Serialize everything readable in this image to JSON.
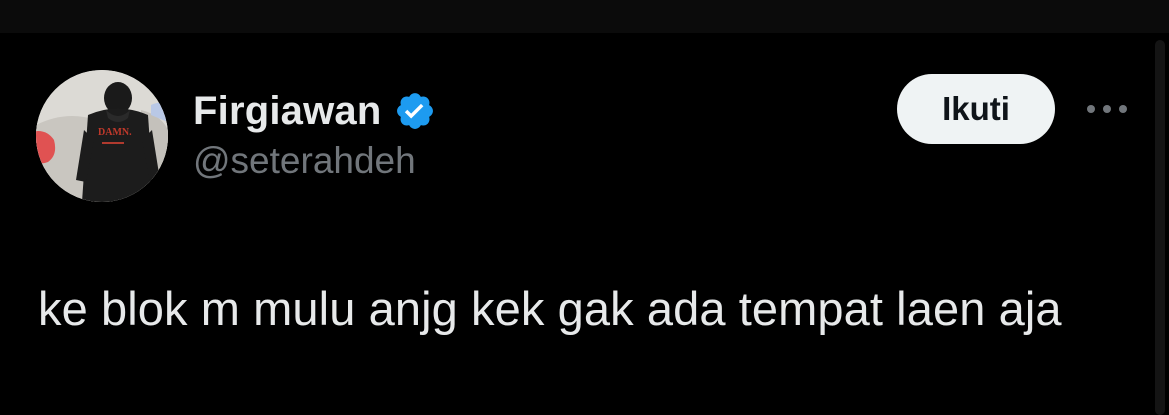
{
  "tweet": {
    "author": {
      "display_name": "Firgiawan",
      "handle": "@seterahdeh",
      "verified": true,
      "avatar_shirt_text": "DAMN."
    },
    "follow_label": "Ikuti",
    "more_icon": "more-horizontal-icon",
    "text": "ke blok m mulu anjg kek gak ada tempat laen aja"
  },
  "colors": {
    "background": "#000000",
    "primary_text": "#e7e9ea",
    "secondary_text": "#71767b",
    "verified_badge": "#1d9bf0",
    "follow_button_bg": "#eff3f4",
    "follow_button_text": "#0f1419"
  }
}
